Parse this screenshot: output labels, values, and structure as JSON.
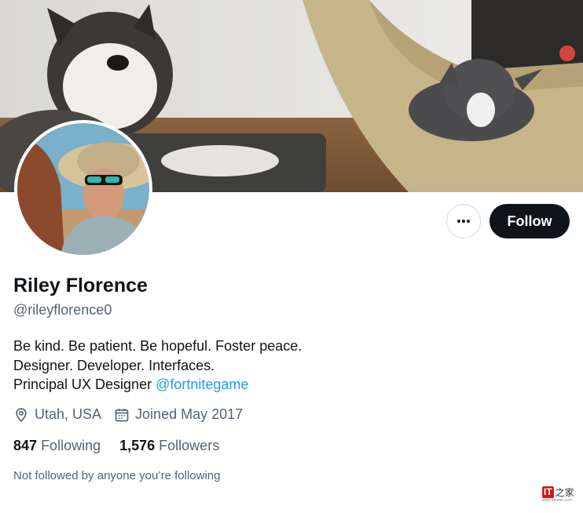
{
  "profile": {
    "display_name": "Riley Florence",
    "handle": "@rileyflorence0",
    "bio_lines": [
      "Be kind. Be patient. Be hopeful. Foster peace.",
      "Designer. Developer. Interfaces."
    ],
    "bio_line3_prefix": "Principal UX Designer ",
    "bio_mention": "@fortnitegame",
    "location": "Utah, USA",
    "joined": "Joined May 2017",
    "following_count": "847",
    "following_label": "Following",
    "followers_count": "1,576",
    "followers_label": "Followers",
    "not_followed_text": "Not followed by anyone you’re following"
  },
  "actions": {
    "follow_label": "Follow",
    "more_icon": "more-horizontal-icon"
  },
  "icons": {
    "location": "location-pin-icon",
    "joined": "calendar-icon"
  },
  "colors": {
    "accent": "#1d9bf0",
    "text_primary": "#0f1419",
    "text_secondary": "#536471",
    "button_bg": "#0f1419"
  },
  "watermark": {
    "mark": "IT",
    "text": "之家",
    "url": "www.ithome.com"
  }
}
